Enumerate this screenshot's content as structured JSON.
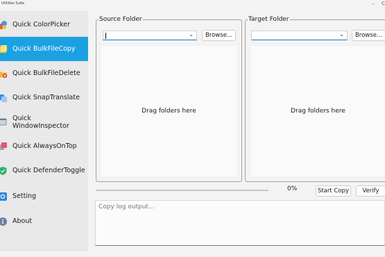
{
  "window": {
    "title": "Utilities Suite"
  },
  "sidebar": {
    "items": [
      {
        "label": "Quick ColorPicker",
        "icon": "color-picker-icon",
        "active": false
      },
      {
        "label": "Quick BulkFileCopy",
        "icon": "bulk-copy-icon",
        "active": true
      },
      {
        "label": "Quick BulkFileDelete",
        "icon": "bulk-delete-icon",
        "active": false
      },
      {
        "label": "Quick SnapTranslate",
        "icon": "snap-translate-icon",
        "active": false
      },
      {
        "label": "Quick WindowInspector",
        "icon": "window-inspector-icon",
        "active": false
      },
      {
        "label": "Quick AlwaysOnTop",
        "icon": "always-on-top-icon",
        "active": false
      },
      {
        "label": "Quick DefenderToggle",
        "icon": "defender-shield-icon",
        "active": false
      },
      {
        "label": "Setting",
        "icon": "settings-icon",
        "active": false
      },
      {
        "label": "About",
        "icon": "info-icon",
        "active": false
      }
    ]
  },
  "source": {
    "legend": "Source Folder",
    "path": "",
    "browse_label": "Browse...",
    "drop_hint": "Drag folders here"
  },
  "target": {
    "legend": "Target Folder",
    "path": "",
    "browse_label": "Browse...",
    "drop_hint": "Drag folders here"
  },
  "progress": {
    "percent_label": "0%",
    "value": 0
  },
  "actions": {
    "start_label": "Start Copy",
    "verify_label": "Verify"
  },
  "log": {
    "placeholder": "Copy log output..."
  },
  "colors": {
    "accent": "#1ba1e2",
    "focus_underline": "#1a73c7"
  }
}
